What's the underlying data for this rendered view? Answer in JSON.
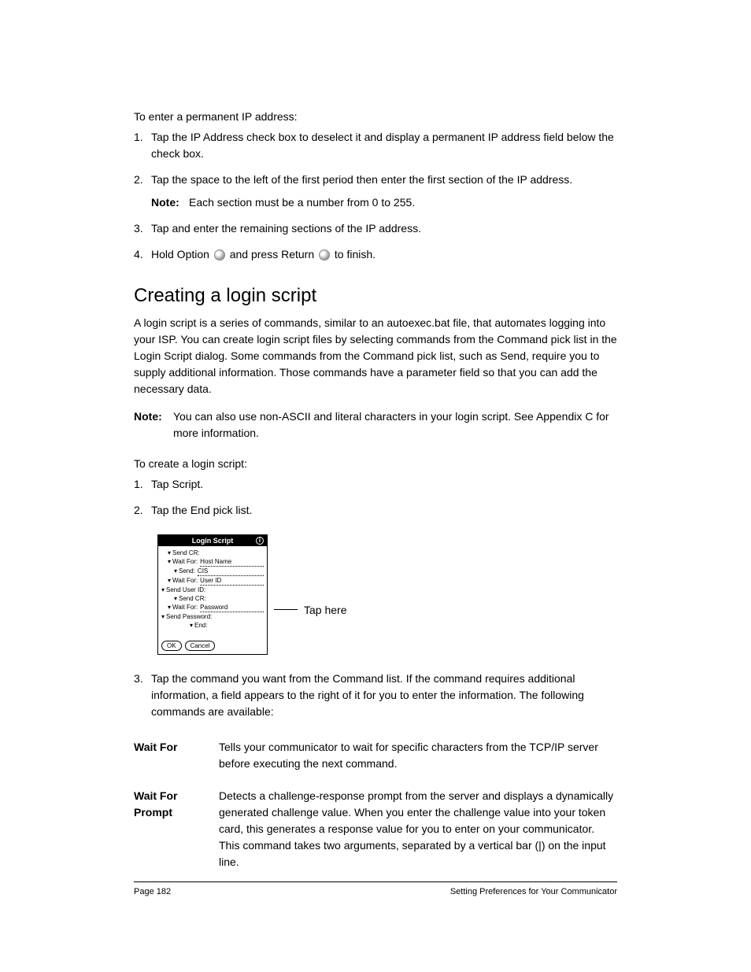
{
  "section1_title": "To enter a permanent IP address:",
  "section1_items": [
    {
      "num": "1.",
      "text": "Tap the IP Address check box to deselect it and display a permanent IP address field below the check box."
    },
    {
      "num": "2.",
      "text": "Tap the space to the left of the first period then enter the first section of the IP address.",
      "note_label": "Note:",
      "note_text": "Each section must be a number from 0 to 255."
    },
    {
      "num": "3.",
      "text": "Tap and enter the remaining sections of the IP address."
    },
    {
      "num": "4.",
      "text_before": "Hold Option ",
      "text_mid": " and press Return ",
      "text_after": " to finish."
    }
  ],
  "heading": "Creating a login script",
  "intro_text": "A login script is a series of commands, similar to an autoexec.bat file, that automates logging into your ISP. You can create login script files by selecting commands from the Command pick list in the Login Script dialog. Some commands from the Command pick list, such as Send, require you to supply additional information. Those commands have a parameter field so that you can add the necessary data.",
  "note2_label": "Note:",
  "note2_text": "You can also use non-ASCII and literal characters in your login script. See Appendix C for more information.",
  "section2_title": "To create a login script:",
  "section2_items_simple": [
    {
      "num": "1.",
      "text": "Tap Script."
    },
    {
      "num": "2.",
      "text": "Tap the End pick list."
    }
  ],
  "palm": {
    "title": "Login Script",
    "rows": [
      {
        "indent": 1,
        "label": "Send CR:"
      },
      {
        "indent": 1,
        "label": "Wait For:",
        "value": "Host Name"
      },
      {
        "indent": 2,
        "label": "Send:",
        "value": "CIS"
      },
      {
        "indent": 1,
        "label": "Wait For:",
        "value": "User ID"
      },
      {
        "indent": 0,
        "label": "Send User ID:"
      },
      {
        "indent": 2,
        "label": "Send CR:"
      },
      {
        "indent": 1,
        "label": "Wait For:",
        "value": "Password"
      },
      {
        "indent": 0,
        "label": "Send Password:"
      },
      {
        "indent": 4,
        "label": "End:"
      }
    ],
    "ok": "OK",
    "cancel": "Cancel"
  },
  "callout": "Tap here",
  "section2_item3": {
    "num": "3.",
    "text": "Tap the command you want from the Command list. If the command requires additional information, a field appears to the right of it for you to enter the information. The following commands are available:"
  },
  "commands": [
    {
      "name": "Wait For",
      "desc": "Tells your communicator to wait for specific characters from the TCP/IP server before executing the next command."
    },
    {
      "name": "Wait For Prompt",
      "desc": "Detects a challenge-response prompt from the server and displays a dynamically generated challenge value. When you enter the challenge value into your token card, this generates a response value for you to enter on your communicator. This command takes two arguments, separated by a vertical bar (|) on the input line."
    }
  ],
  "footer_left": "Page 182",
  "footer_right": "Setting Preferences for Your Communicator"
}
